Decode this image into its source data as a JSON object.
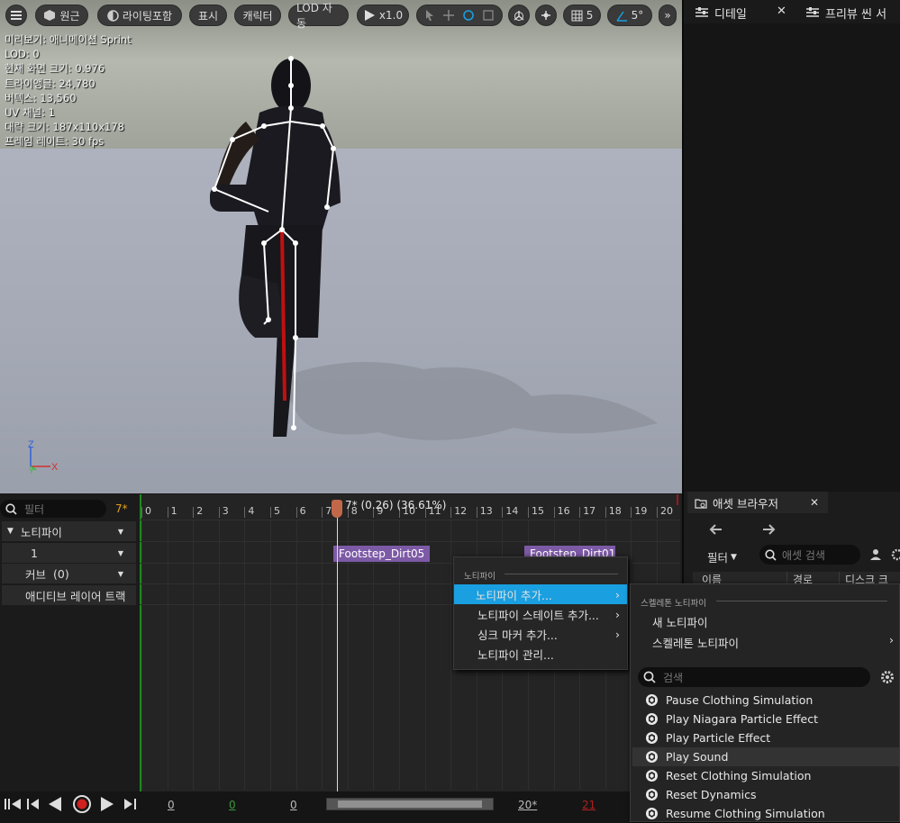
{
  "toolbar": {
    "perspective_label": "원근",
    "lighting_label": "라이팅포함",
    "show_label": "표시",
    "character_label": "캐릭터",
    "lod_label": "LOD 자동",
    "play_speed_label": "x1.0",
    "grid_value": "5",
    "angle_value": "5°"
  },
  "stats": [
    "미리보기: 애니메이션 Sprint",
    "LOD: 0",
    "현재 화면 크기: 0.976",
    "트라이앵글: 24,780",
    "버텍스: 13,560",
    "UV 채널: 1",
    "대략 크기: 187x110x178",
    "프레임 레이트: 30 fps"
  ],
  "axis": {
    "z": "Z",
    "y": "Y",
    "x": "X"
  },
  "panels": {
    "details_tab": "디테일",
    "preview_scene_tab": "프리뷰 씬 서",
    "asset_browser_tab": "애셋 브라우저",
    "filter_label": "필터",
    "asset_search_placeholder": "애셋 검색",
    "col_name": "이름",
    "col_path": "경로",
    "col_disk": "디스크 크"
  },
  "timeline": {
    "filter_placeholder": "필터",
    "frame_badge": "7*",
    "playhead_label": "7* (0.26) (36.61%)",
    "ticks": [
      "0",
      "1",
      "2",
      "3",
      "4",
      "5",
      "6",
      "7",
      "8",
      "9",
      "10",
      "11",
      "12",
      "13",
      "14",
      "15",
      "16",
      "17",
      "18",
      "19",
      "20"
    ],
    "tracks": {
      "notifies": "노티파이",
      "track_1": "1",
      "curves": "커브",
      "curves_count": "(0)",
      "additive": "애디티브 레이어 트랙"
    },
    "notify_1": "Footstep_Dirt05",
    "notify_2": "Footstep_Dirt01"
  },
  "transport": {
    "start": "0",
    "green": "0",
    "current": "0",
    "end_frame": "20*",
    "red_frame": "21"
  },
  "context_menu": {
    "section": "노티파이",
    "items": [
      "노티파이 추가...",
      "노티파이 스테이트 추가...",
      "싱크 마커 추가...",
      "노티파이 관리..."
    ]
  },
  "submenu": {
    "section": "스켈레톤 노티파이",
    "new_notify": "새 노티파이",
    "skeleton_notify": "스켈레톤 노티파이",
    "search_placeholder": "검색",
    "items": [
      "Pause Clothing Simulation",
      "Play Niagara Particle Effect",
      "Play Particle Effect",
      "Play Sound",
      "Reset Clothing Simulation",
      "Reset Dynamics",
      "Resume Clothing Simulation"
    ]
  },
  "colors": {
    "accent_blue": "#1a9fe0",
    "highlight": "#1a9fe0",
    "notify_purple": "#7d5aa6",
    "playhead": "#c2684a"
  }
}
